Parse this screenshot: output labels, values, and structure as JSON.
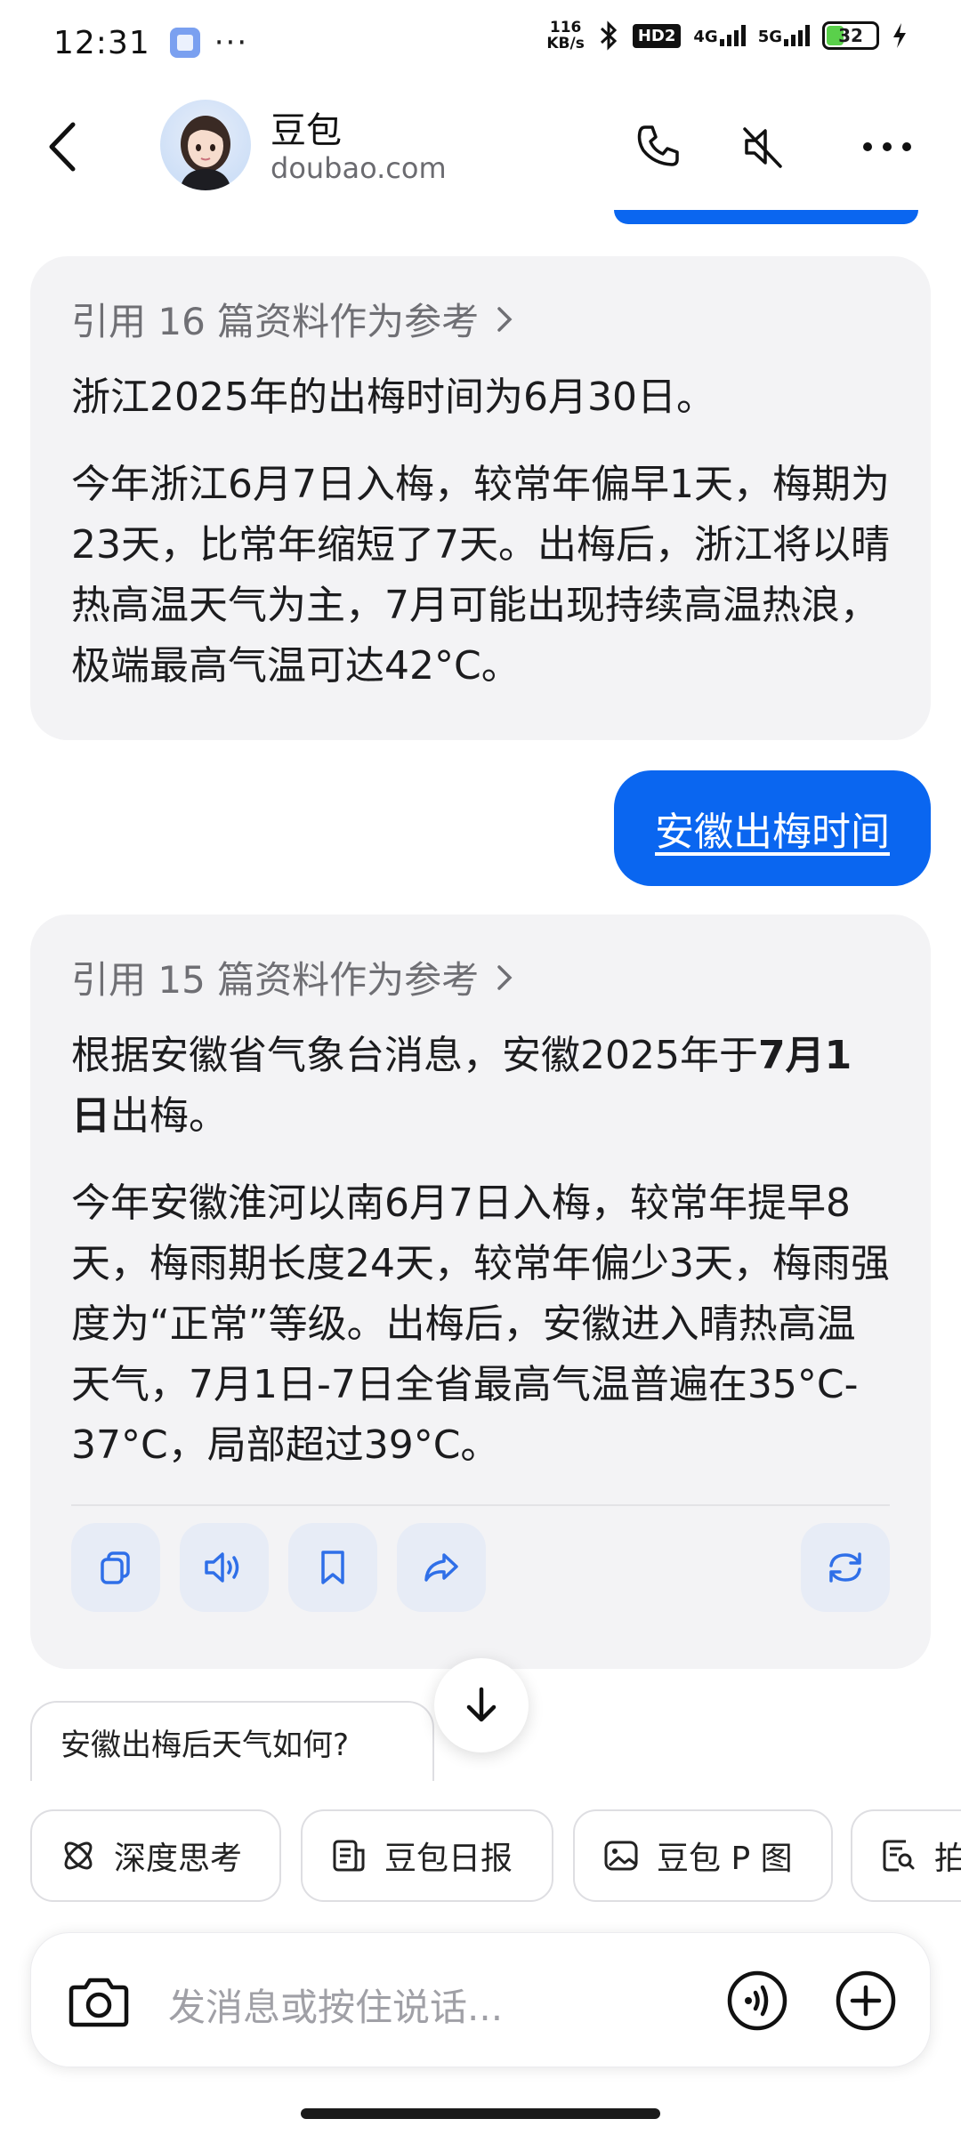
{
  "status_bar": {
    "time": "12:31",
    "dots": "···",
    "net_speed_value": "116",
    "net_speed_unit": "KB/s",
    "hd_label": "HD2",
    "sig1_label": "4G",
    "sig2_label": "5G",
    "battery": "32",
    "battery_level": 0.32
  },
  "header": {
    "name": "豆包",
    "domain": "doubao.com"
  },
  "messages": {
    "bot1": {
      "ref_text": "引用 16 篇资料作为参考",
      "para1": "浙江2025年的出梅时间为6月30日。",
      "para2": "今年浙江6月7日入梅，较常年偏早1天，梅期为23天，比常年缩短了7天。出梅后，浙江将以晴热高温天气为主，7月可能出现持续高温热浪，极端最高气温可达42°C。"
    },
    "user1": {
      "text": "安徽出梅时间"
    },
    "bot2": {
      "ref_text": "引用 15 篇资料作为参考",
      "para1_prefix": "根据安徽省气象台消息，安徽2025年于",
      "para1_bold": "7月1日",
      "para1_suffix": "出梅。",
      "para2": "今年安徽淮河以南6月7日入梅，较常年提早8天，梅雨期长度24天，较常年偏少3天，梅雨强度为“正常”等级。出梅后，安徽进入晴热高温天气，7月1日-7日全省最高气温普遍在35°C-37°C，局部超过39°C。"
    }
  },
  "suggestion": "安徽出梅后天气如何?",
  "tools": [
    {
      "label": "深度思考",
      "icon": "atom-icon"
    },
    {
      "label": "豆包日报",
      "icon": "newspaper-icon"
    },
    {
      "label": "豆包 P 图",
      "icon": "image-edit-icon"
    },
    {
      "label": "拍",
      "icon": "scan-doc-icon"
    }
  ],
  "input": {
    "placeholder": "发消息或按住说话..."
  }
}
